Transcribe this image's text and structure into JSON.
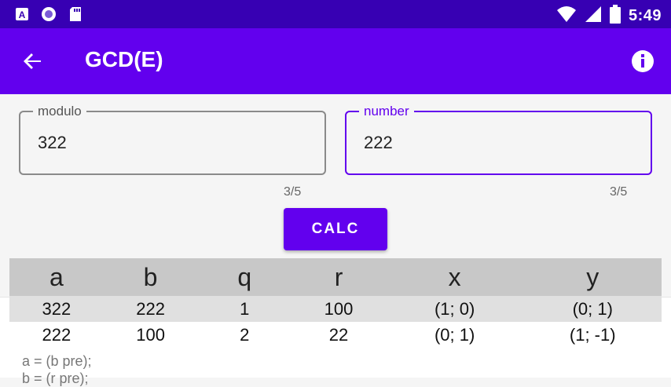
{
  "status_bar": {
    "time": "5:49",
    "left_icons": [
      "accessibility-icon",
      "circle-dot-icon",
      "sd-card-icon"
    ],
    "right_icons": [
      "wifi-icon",
      "signal-icon",
      "battery-icon"
    ]
  },
  "app_bar": {
    "title": "GCD(E)",
    "background": "#6200ee"
  },
  "fields": {
    "modulo": {
      "label": "modulo",
      "value": "322",
      "counter": "3/5"
    },
    "number": {
      "label": "number",
      "value": "222",
      "counter": "3/5"
    }
  },
  "calc_button": {
    "label": "CALC"
  },
  "table": {
    "headers": [
      "a",
      "b",
      "q",
      "r",
      "x",
      "y"
    ],
    "rows": [
      [
        "322",
        "222",
        "1",
        "100",
        "(1; 0)",
        "(0; 1)"
      ],
      [
        "222",
        "100",
        "2",
        "22",
        "(0; 1)",
        "(1; -1)"
      ]
    ]
  },
  "notes": [
    "a = (b pre);",
    "b = (r pre);"
  ],
  "colors": {
    "accent": "#6200ee",
    "status_bar": "#3700b3"
  }
}
